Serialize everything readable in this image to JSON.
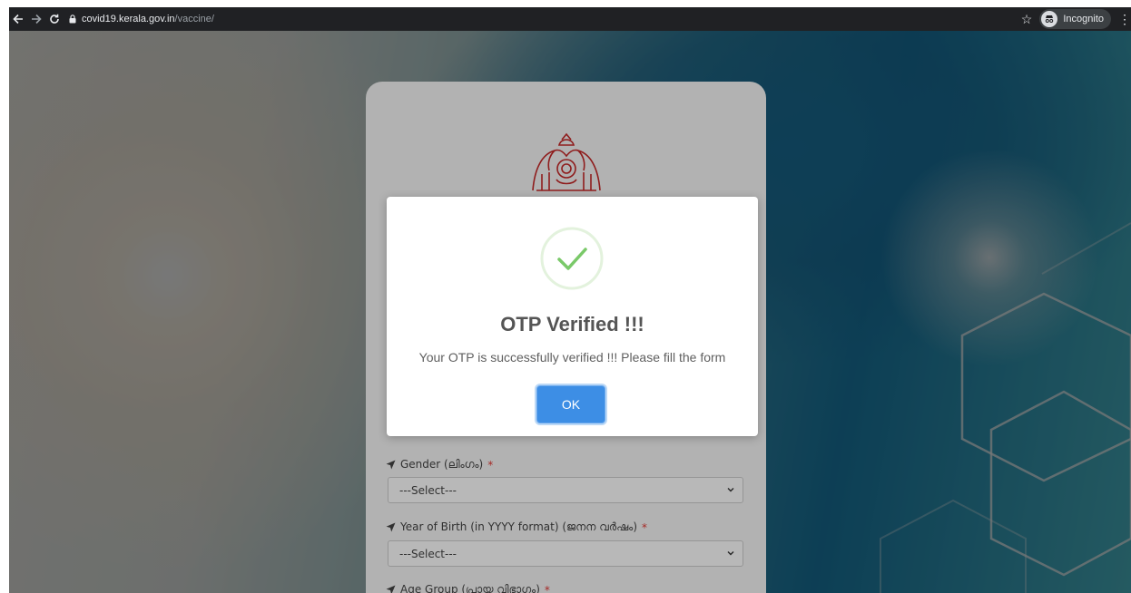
{
  "browser": {
    "url_host": "covid19.kerala.gov.in",
    "url_path": "/vaccine/",
    "incognito_label": "Incognito"
  },
  "form": {
    "fields": [
      {
        "label": "Gender (ലിംഗം)",
        "required_mark": "*",
        "select_value": "---Select---"
      },
      {
        "label": "Year of Birth (in YYYY format) (ജനന വർഷം)",
        "required_mark": "*",
        "select_value": "---Select---"
      },
      {
        "label": "Age Group (പ്രായ വിഭാഗം)",
        "required_mark": "*"
      }
    ]
  },
  "modal": {
    "title": "OTP Verified !!!",
    "message": "Your OTP is successfully verified !!! Please fill the form",
    "ok_label": "OK",
    "success_color": "#7ac969",
    "button_color": "#3d8ee5"
  },
  "icons": {
    "emblem": "kerala-emblem",
    "check": "checkmark-icon",
    "field_marker": "location-arrow-icon"
  }
}
